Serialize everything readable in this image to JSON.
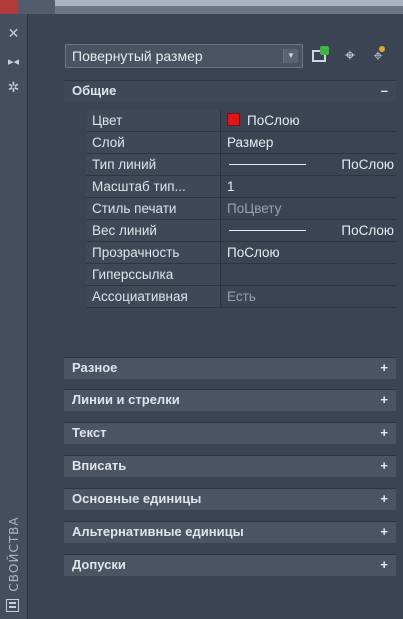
{
  "palette": {
    "title": "СВОЙСТВА",
    "selector": {
      "value": "Повернутый размер"
    },
    "toolbar": [
      "quick-select-icon",
      "select-objects-icon",
      "pickadd-icon"
    ]
  },
  "sections": [
    {
      "label": "Общие",
      "expanded": true,
      "sign": "–"
    },
    {
      "label": "Разное",
      "expanded": false,
      "sign": "+"
    },
    {
      "label": "Линии и стрелки",
      "expanded": false,
      "sign": "+"
    },
    {
      "label": "Текст",
      "expanded": false,
      "sign": "+"
    },
    {
      "label": "Вписать",
      "expanded": false,
      "sign": "+"
    },
    {
      "label": "Основные единицы",
      "expanded": false,
      "sign": "+"
    },
    {
      "label": "Альтернативные единицы",
      "expanded": false,
      "sign": "+"
    },
    {
      "label": "Допуски",
      "expanded": false,
      "sign": "+"
    }
  ],
  "general": [
    {
      "name": "Цвет",
      "value": "ПоСлою",
      "swatch": "#e01616"
    },
    {
      "name": "Слой",
      "value": "Размер"
    },
    {
      "name": "Тип линий",
      "value": "ПоСлою"
    },
    {
      "name": "Масштаб тип...",
      "value": "1"
    },
    {
      "name": "Стиль печати",
      "value": "ПоЦвету"
    },
    {
      "name": "Вес линий",
      "value": "ПоСлою"
    },
    {
      "name": "Прозрачность",
      "value": "ПоСлою"
    },
    {
      "name": "Гиперссылка",
      "value": ""
    },
    {
      "name": "Ассоциативная",
      "value": "Есть"
    }
  ]
}
